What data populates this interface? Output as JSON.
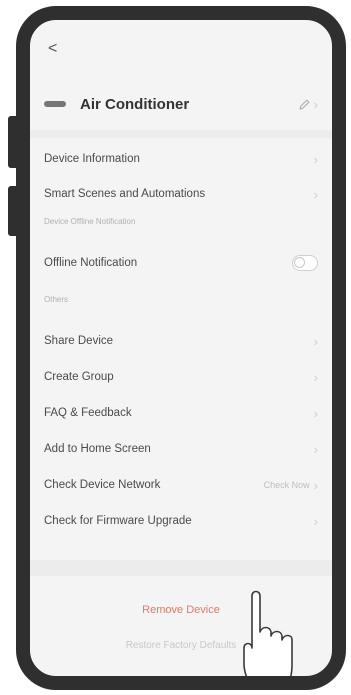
{
  "nav": {
    "back_glyph": "<"
  },
  "device": {
    "name": "Air Conditioner",
    "edit_icon": "pencil-icon"
  },
  "settings": {
    "device_information": "Device Information",
    "smart_scenes": "Smart Scenes and Automations",
    "section_offline": "Device Offline Notification",
    "offline_notification": "Offline Notification",
    "offline_notification_enabled": false,
    "section_others": "Others",
    "share_device": "Share Device",
    "create_group": "Create Group",
    "faq_feedback": "FAQ & Feedback",
    "add_home_screen": "Add to Home Screen",
    "check_network": "Check Device Network",
    "check_now": "Check Now",
    "firmware_upgrade": "Check for Firmware Upgrade"
  },
  "actions": {
    "remove_device": "Remove Device",
    "restore_defaults": "Restore Factory Defaults"
  },
  "colors": {
    "phone_frame": "#2f2f2f",
    "screen_bg": "#f4f4f4",
    "remove_text": "#e07a66"
  }
}
